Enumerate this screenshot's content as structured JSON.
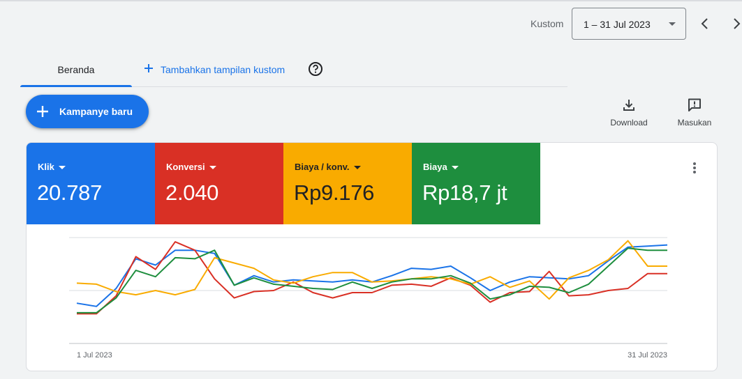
{
  "header": {
    "range_label": "Kustom",
    "date_range": "1 – 31 Jul 2023",
    "prev_icon": "chevron-left-icon",
    "next_icon": "chevron-right-icon"
  },
  "tabs": {
    "home": "Beranda",
    "add_custom": "Tambahkan tampilan kustom",
    "help_icon": "help-circle-icon"
  },
  "actions": {
    "new_campaign": "Kampanye baru",
    "download": "Download",
    "feedback": "Masukan"
  },
  "metrics": [
    {
      "label": "Klik",
      "value": "20.787",
      "color": "#1a73e8"
    },
    {
      "label": "Konversi",
      "value": "2.040",
      "color": "#d93025"
    },
    {
      "label": "Biaya / konv.",
      "value": "Rp9.176",
      "color": "#f9ab00"
    },
    {
      "label": "Biaya",
      "value": "Rp18,7 jt",
      "color": "#1e8e3e"
    }
  ],
  "chart_data": {
    "type": "line",
    "x_start_label": "1 Jul 2023",
    "x_end_label": "31 Jul 2023",
    "note_scale": "relative (no y tick labels shown)",
    "series": [
      {
        "name": "Klik",
        "color": "#1a73e8",
        "values": [
          0.38,
          0.35,
          0.52,
          0.8,
          0.74,
          0.88,
          0.88,
          0.85,
          0.55,
          0.64,
          0.58,
          0.6,
          0.59,
          0.58,
          0.6,
          0.58,
          0.64,
          0.71,
          0.7,
          0.73,
          0.62,
          0.5,
          0.58,
          0.63,
          0.62,
          0.61,
          0.64,
          0.78,
          0.91,
          0.92,
          0.93
        ]
      },
      {
        "name": "Konversi",
        "color": "#d93025",
        "values": [
          0.28,
          0.28,
          0.45,
          0.82,
          0.7,
          0.96,
          0.88,
          0.61,
          0.43,
          0.49,
          0.5,
          0.58,
          0.48,
          0.43,
          0.48,
          0.48,
          0.55,
          0.56,
          0.54,
          0.62,
          0.55,
          0.39,
          0.48,
          0.49,
          0.68,
          0.45,
          0.46,
          0.5,
          0.52,
          0.66,
          0.66
        ]
      },
      {
        "name": "Biaya / konv.",
        "color": "#f9ab00",
        "values": [
          0.57,
          0.56,
          0.49,
          0.46,
          0.5,
          0.46,
          0.51,
          0.81,
          0.76,
          0.71,
          0.6,
          0.57,
          0.63,
          0.67,
          0.67,
          0.58,
          0.59,
          0.61,
          0.63,
          0.61,
          0.56,
          0.63,
          0.53,
          0.59,
          0.42,
          0.62,
          0.69,
          0.79,
          0.97,
          0.73,
          0.73
        ]
      },
      {
        "name": "Biaya",
        "color": "#1e8e3e",
        "values": [
          0.29,
          0.29,
          0.43,
          0.69,
          0.63,
          0.81,
          0.8,
          0.88,
          0.55,
          0.62,
          0.56,
          0.54,
          0.52,
          0.51,
          0.58,
          0.52,
          0.58,
          0.61,
          0.61,
          0.64,
          0.57,
          0.42,
          0.46,
          0.54,
          0.53,
          0.48,
          0.56,
          0.73,
          0.9,
          0.88,
          0.88
        ]
      }
    ]
  }
}
